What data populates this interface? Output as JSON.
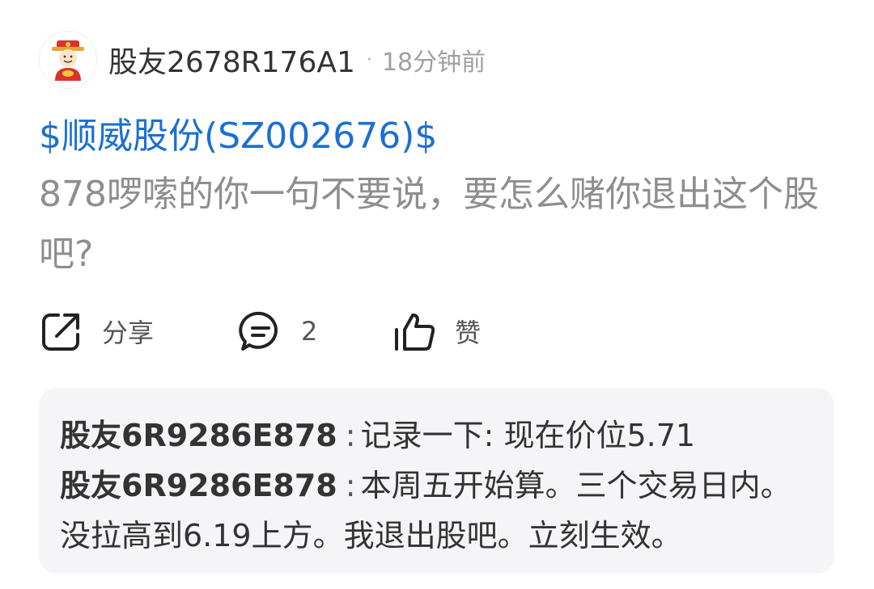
{
  "header": {
    "username": "股友2678R176A1",
    "dot": "·",
    "time": "18分钟前"
  },
  "post": {
    "stock_link": "$顺威股份(SZ002676)$",
    "text": "878啰嗦的你一句不要说，要怎么赌你退出这个股吧?"
  },
  "actions": {
    "share_label": "分享",
    "comment_count": "2",
    "like_label": "赞"
  },
  "comments": [
    {
      "author": "股友6R9286E878",
      "sep": ":",
      "text": "记录一下:  现在价位5.71"
    },
    {
      "author": "股友6R9286E878",
      "sep": ":",
      "text": "本周五开始算。三个交易日内。没拉高到6.19上方。我退出股吧。立刻生效。"
    }
  ],
  "colors": {
    "link": "#1a6fd3",
    "body_text": "#8e8e8e",
    "box_bg": "#f5f5f7"
  },
  "icons": {
    "avatar": "caishen-avatar-icon",
    "share": "share-icon",
    "comment": "comment-icon",
    "like": "thumbs-up-icon"
  }
}
